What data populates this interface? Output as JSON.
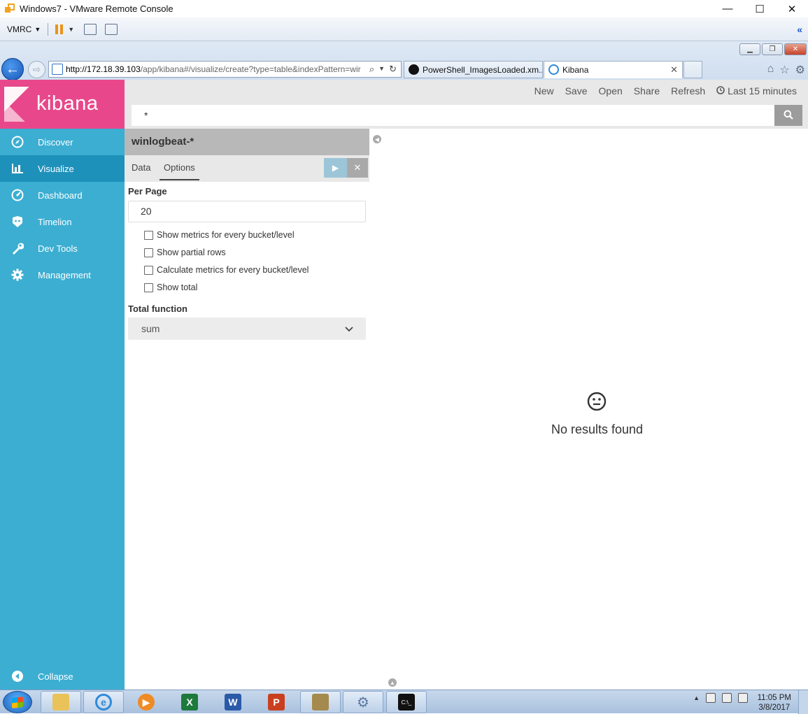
{
  "vm_window": {
    "title": "Windows7 - VMware Remote Console",
    "minimize": "—",
    "maximize": "☐",
    "close": "✕"
  },
  "vmrc_toolbar": {
    "menu_label": "VMRC",
    "collapse": "«"
  },
  "browser": {
    "url_host": "http://172.18.39.103",
    "url_path": "/app/kibana#/visualize/create?type=table&indexPattern=wir",
    "tabs": [
      {
        "label": "PowerShell_ImagesLoaded.xm...",
        "icon": "github-icon"
      },
      {
        "label": "Kibana",
        "icon": "ie-icon",
        "close": "✕"
      }
    ]
  },
  "kibana": {
    "brand": "kibana",
    "nav": [
      {
        "label": "Discover",
        "icon": "compass-icon"
      },
      {
        "label": "Visualize",
        "icon": "bar-chart-icon"
      },
      {
        "label": "Dashboard",
        "icon": "dashboard-icon"
      },
      {
        "label": "Timelion",
        "icon": "timelion-icon"
      },
      {
        "label": "Dev Tools",
        "icon": "wrench-icon"
      },
      {
        "label": "Management",
        "icon": "gear-icon"
      }
    ],
    "active_nav": "Visualize",
    "collapse_label": "Collapse",
    "top_menu": {
      "new": "New",
      "save": "Save",
      "open": "Open",
      "share": "Share",
      "refresh": "Refresh",
      "time_range": "Last 15 minutes"
    },
    "query": "*",
    "editor": {
      "index_pattern": "winlogbeat-*",
      "tabs": [
        "Data",
        "Options"
      ],
      "active_tab": "Options",
      "apply_icon": "▶",
      "discard_icon": "✕",
      "per_page_label": "Per Page",
      "per_page_value": "20",
      "checkboxes": [
        {
          "label": "Show metrics for every bucket/level",
          "checked": false
        },
        {
          "label": "Show partial rows",
          "checked": false
        },
        {
          "label": "Calculate metrics for every bucket/level",
          "checked": false
        },
        {
          "label": "Show total",
          "checked": false
        }
      ],
      "total_function_label": "Total function",
      "total_function_value": "sum"
    },
    "visualization": {
      "no_results": "No results found"
    }
  },
  "taskbar": {
    "apps": [
      "explorer-icon",
      "ie-icon",
      "media-player-icon",
      "excel-icon",
      "word-icon",
      "powerpoint-icon",
      "archive-icon",
      "settings-icon",
      "cmd-icon"
    ],
    "time": "11:05 PM",
    "date": "3/8/2017"
  },
  "colors": {
    "kibana_pink": "#e8488b",
    "kibana_sidebar": "#3caed2",
    "kibana_sidebar_active": "#1e91bb",
    "editor_header": "#b8b8b8"
  }
}
